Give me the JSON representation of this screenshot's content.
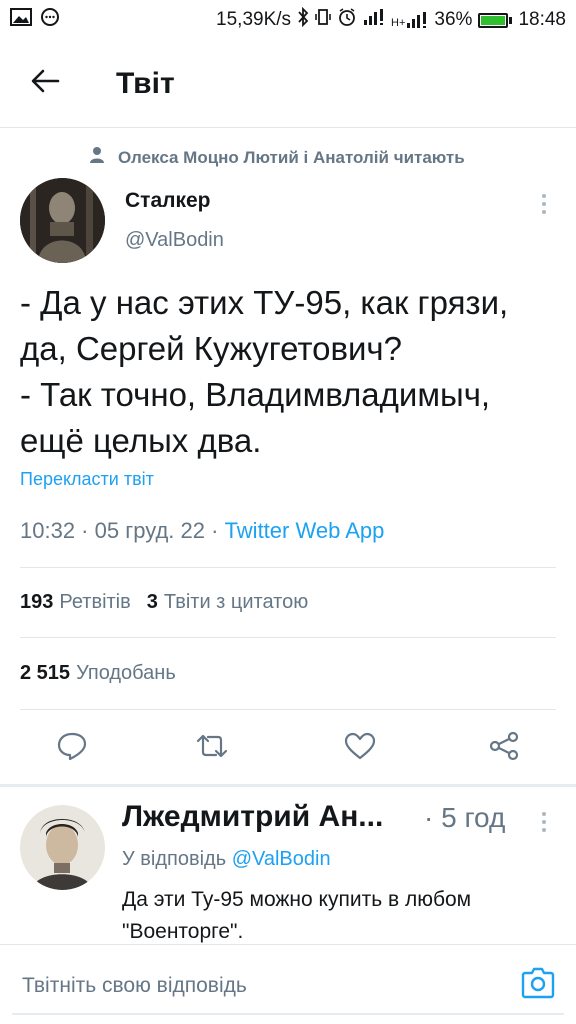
{
  "status_bar": {
    "net_speed": "15,39K/s",
    "battery": "36%",
    "time": "18:48",
    "network_label": "H+",
    "icons": [
      "image-icon",
      "chat-icon",
      "bluetooth-icon",
      "vibrate-icon",
      "alarm-icon",
      "signal-icon",
      "signal-h-icon",
      "battery-icon"
    ]
  },
  "header": {
    "back_icon": "arrow-left-icon",
    "title": "Твіт"
  },
  "social_context": {
    "icon": "person-icon",
    "text": "Олекса Моцно Лютий і Анатолій читають"
  },
  "tweet": {
    "author_name": "Сталкер",
    "author_handle": "@ValBodin",
    "text_lines": [
      "- Да у нас этих ТУ-95, как грязи,",
      "да, Сергей Кужугетович?",
      "- Так точно, Владимвладимыч,",
      "ещё целых два."
    ],
    "translate_label": "Перекласти твіт",
    "time": "10:32 · 05 груд. 22 · ",
    "app": "Twitter Web App",
    "retweets_count": "193",
    "retweets_label": "Ретвітів",
    "quotes_count": "3",
    "quotes_label": "Твіти з цитатою",
    "likes_count": "2 515",
    "likes_label": "Уподобань"
  },
  "actions": [
    "reply-icon",
    "retweet-icon",
    "like-icon",
    "share-icon"
  ],
  "reply": {
    "author_name": "Лжедмитрий Ан...",
    "time": "· 5 год",
    "reply_to_label": "У відповідь",
    "reply_to_handle": "@ValBodin",
    "text_lines": [
      "Да эти Ту-95 можно купить в любом",
      "\"Военторге\"."
    ]
  },
  "composer": {
    "placeholder": "Твітніть свою відповідь",
    "camera_icon": "camera-icon"
  },
  "colors": {
    "accent": "#1da1f2",
    "secondary_text": "#657786",
    "battery": "#2fbf2f"
  }
}
